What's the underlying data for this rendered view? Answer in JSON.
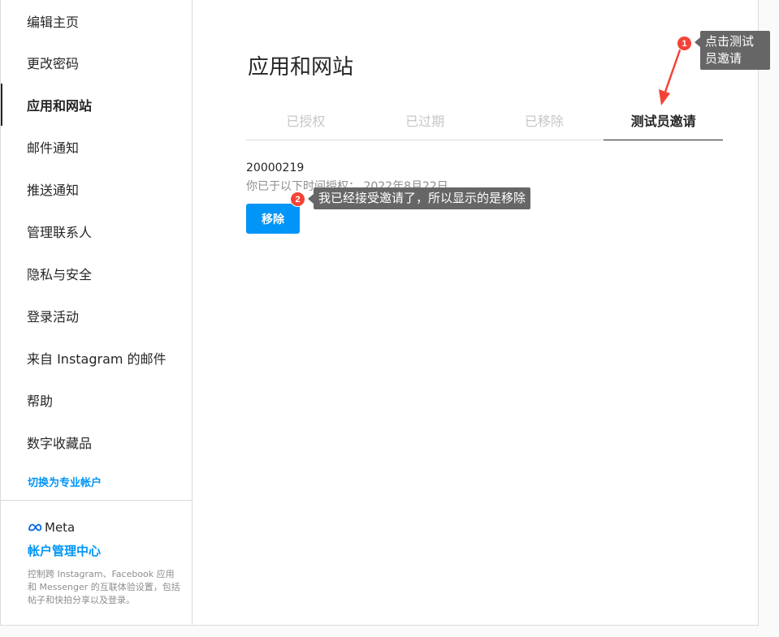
{
  "sidebar": {
    "items": [
      {
        "label": "编辑主页"
      },
      {
        "label": "更改密码"
      },
      {
        "label": "应用和网站"
      },
      {
        "label": "邮件通知"
      },
      {
        "label": "推送通知"
      },
      {
        "label": "管理联系人"
      },
      {
        "label": "隐私与安全"
      },
      {
        "label": "登录活动"
      },
      {
        "label": "来自 Instagram 的邮件"
      },
      {
        "label": "帮助"
      },
      {
        "label": "数字收藏品"
      }
    ],
    "active_index": 2,
    "switch_link": "切换为专业帐户",
    "meta": {
      "logo_text": "Meta",
      "accounts_center": "帐户管理中心",
      "description": "控制跨 Instagram、Facebook 应用和 Messenger 的互联体验设置，包括帖子和快拍分享以及登录。"
    }
  },
  "main": {
    "title": "应用和网站",
    "tabs": [
      {
        "label": "已授权"
      },
      {
        "label": "已过期"
      },
      {
        "label": "已移除"
      },
      {
        "label": "测试员邀请"
      }
    ],
    "active_tab": 3,
    "invite": {
      "app_id": "20000219",
      "auth_text": "你已于以下时间授权： 2022年8月22日",
      "remove_label": "移除"
    }
  },
  "annotations": [
    {
      "number": "1",
      "text": "点击测试员邀请",
      "color": "#f44336"
    },
    {
      "number": "2",
      "text": "我已经接受邀请了，所以显示的是移除",
      "color": "#f44336"
    }
  ]
}
